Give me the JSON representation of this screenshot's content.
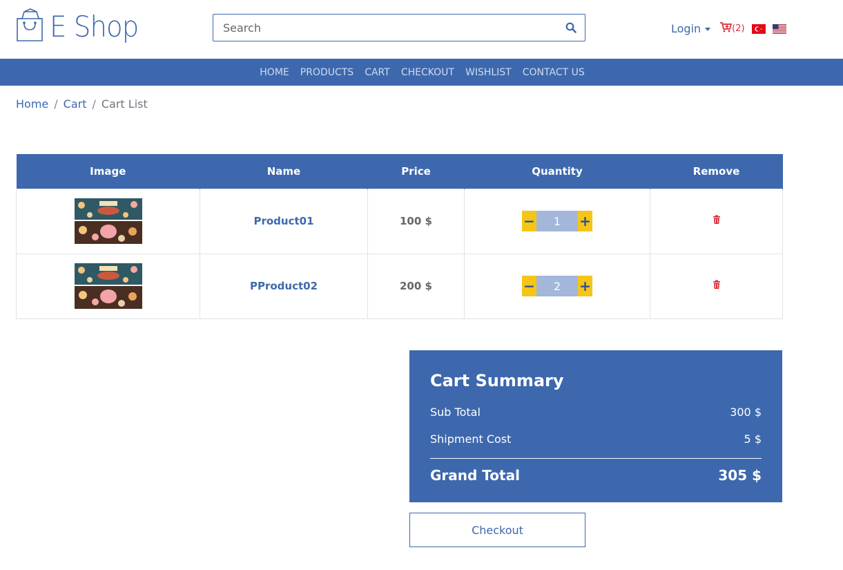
{
  "brand": {
    "name": "E Shop",
    "color": "#3d68ad"
  },
  "search": {
    "placeholder": "Search"
  },
  "header": {
    "login_label": "Login",
    "cart_count": "(2)"
  },
  "nav": {
    "items": [
      "HOME",
      "PRODUCTS",
      "CART",
      "CHECKOUT",
      "WISHLIST",
      "CONTACT US"
    ]
  },
  "breadcrumb": {
    "items": [
      "Home",
      "Cart",
      "Cart List"
    ]
  },
  "table": {
    "headers": [
      "Image",
      "Name",
      "Price",
      "Quantity",
      "Remove"
    ],
    "rows": [
      {
        "name": "Product01",
        "price": "100 $",
        "quantity": "1"
      },
      {
        "name": "PProduct02",
        "price": "200 $",
        "quantity": "2"
      }
    ]
  },
  "summary": {
    "title": "Cart Summary",
    "subtotal_label": "Sub Total",
    "subtotal_value": "300 $",
    "shipment_label": "Shipment Cost",
    "shipment_value": "5 $",
    "grand_label": "Grand Total",
    "grand_value": "305 $"
  },
  "checkout_label": "Checkout",
  "colors": {
    "accent": "#3d68ad",
    "qty_button": "#f5c518",
    "qty_value": "#a3b7da",
    "danger": "#d92a36"
  }
}
